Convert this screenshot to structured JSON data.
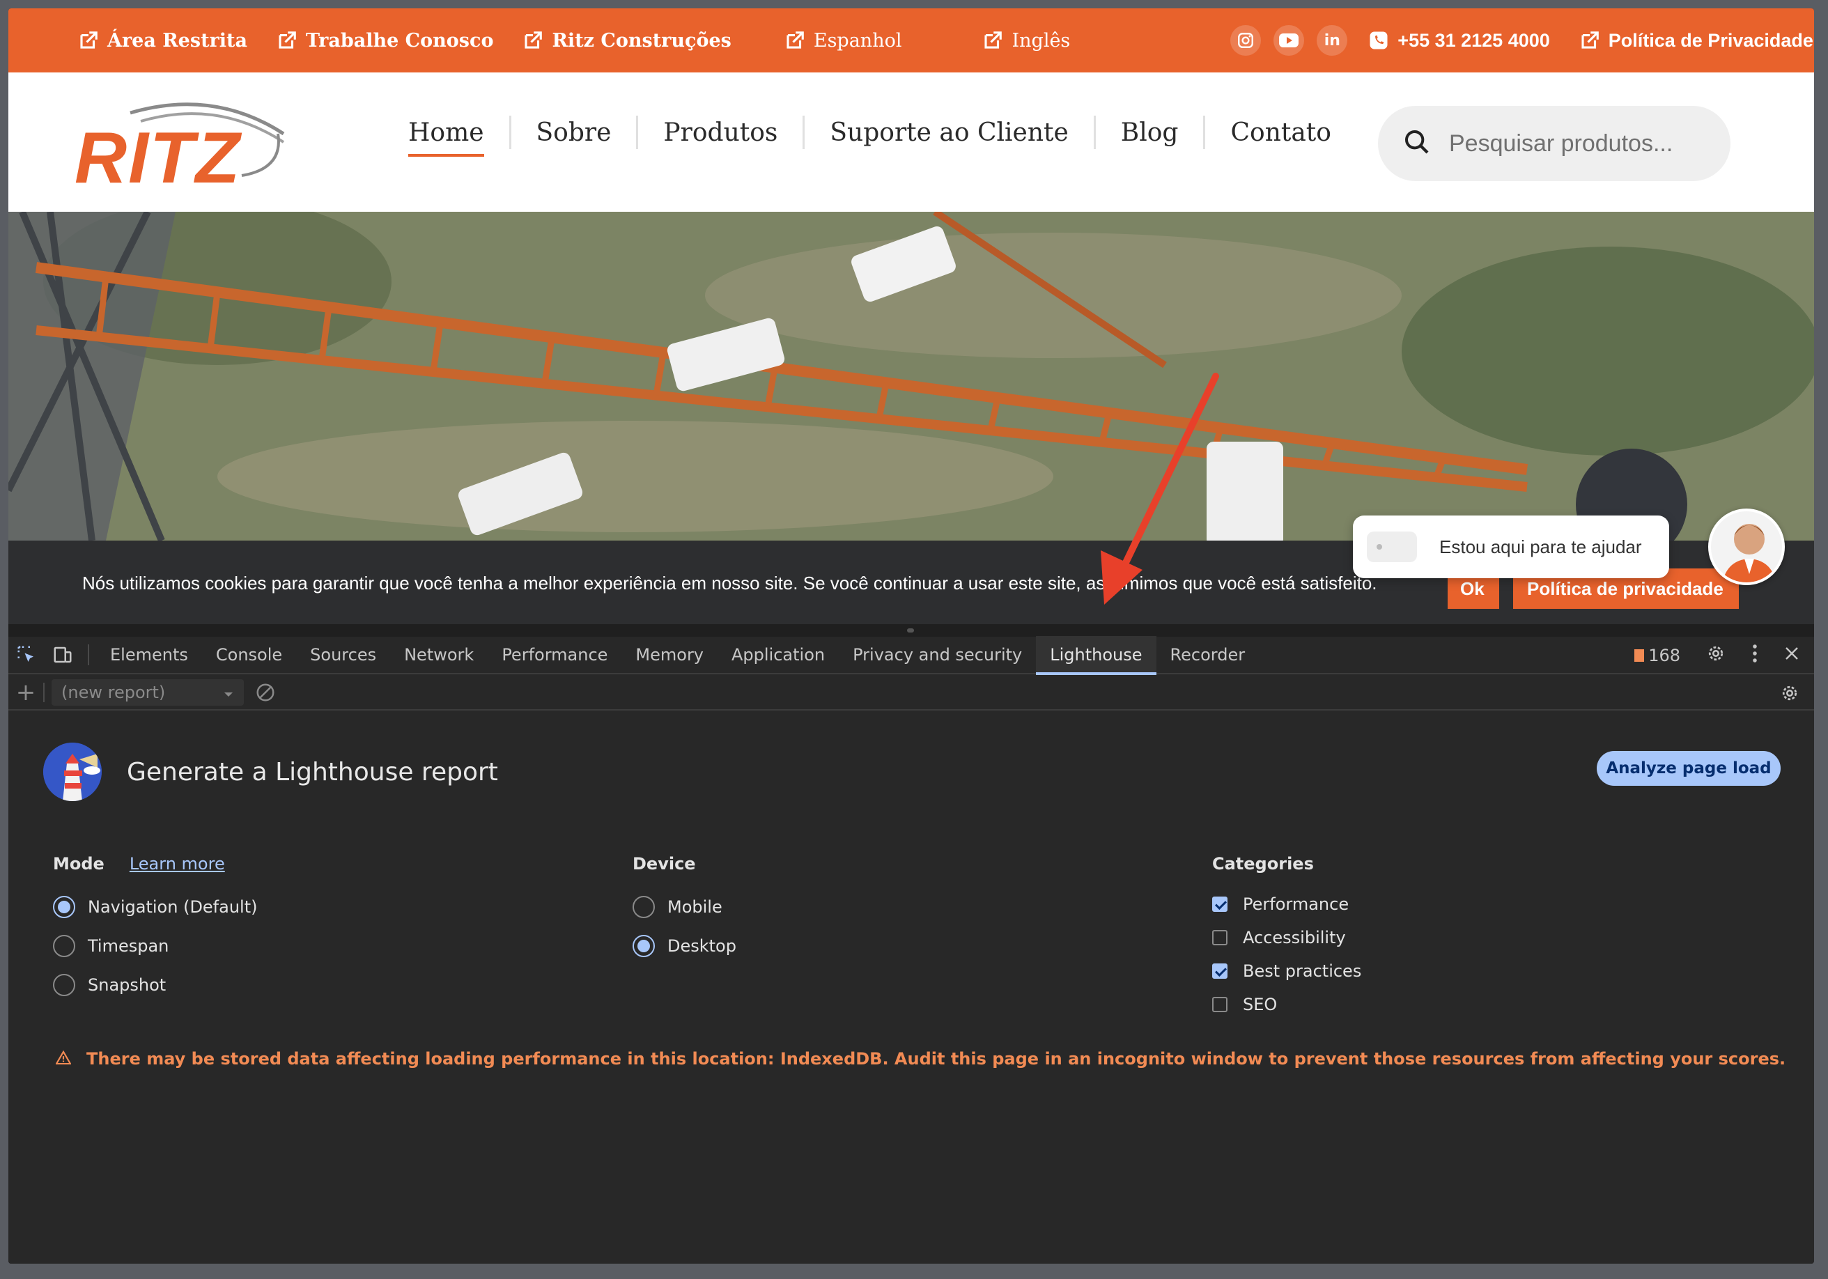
{
  "topbar": {
    "links": [
      {
        "label": "Área Restrita",
        "icon": "external-link-icon"
      },
      {
        "label": "Trabalhe Conosco",
        "icon": "external-link-icon"
      },
      {
        "label": "Ritz Construções",
        "icon": "external-link-icon"
      },
      {
        "label": "Espanhol",
        "icon": "external-link-icon"
      },
      {
        "label": "Inglês",
        "icon": "external-link-icon"
      }
    ],
    "social": [
      "instagram-icon",
      "youtube-icon",
      "linkedin-icon"
    ],
    "linkedin_glyph": "in",
    "phone": "+55 31 2125 4000",
    "privacy": "Política de Privacidade",
    "color": "#e8622c"
  },
  "header": {
    "logo_text": "RITZ",
    "nav": [
      "Home",
      "Sobre",
      "Produtos",
      "Suporte ao Cliente",
      "Blog",
      "Contato"
    ],
    "search_placeholder": "Pesquisar produtos..."
  },
  "cookie": {
    "message": "Nós utilizamos cookies para garantir que você tenha a melhor experiência em nosso site. Se você continuar a usar este site, assumimos que você está satisfeito.",
    "ok": "Ok",
    "privacy": "Política de privacidade"
  },
  "chat": {
    "bubble": "Estou aqui para te ajudar"
  },
  "devtools": {
    "tabs": [
      "Elements",
      "Console",
      "Sources",
      "Network",
      "Performance",
      "Memory",
      "Application",
      "Privacy and security",
      "Lighthouse",
      "Recorder"
    ],
    "active_tab": "Lighthouse",
    "issues_count": "168",
    "report_select": "(new report)",
    "title": "Generate a Lighthouse report",
    "analyze_button": "Analyze page load",
    "mode": {
      "label": "Mode",
      "learn_more": "Learn more",
      "options": [
        "Navigation (Default)",
        "Timespan",
        "Snapshot"
      ],
      "selected": "Navigation (Default)"
    },
    "device": {
      "label": "Device",
      "options": [
        "Mobile",
        "Desktop"
      ],
      "selected": "Desktop"
    },
    "categories": {
      "label": "Categories",
      "items": [
        {
          "label": "Performance",
          "checked": true
        },
        {
          "label": "Accessibility",
          "checked": false
        },
        {
          "label": "Best practices",
          "checked": true
        },
        {
          "label": "SEO",
          "checked": false
        }
      ]
    },
    "warning": "There may be stored data affecting loading performance in this location: IndexedDB. Audit this page in an incognito window to prevent those resources from affecting your scores."
  }
}
